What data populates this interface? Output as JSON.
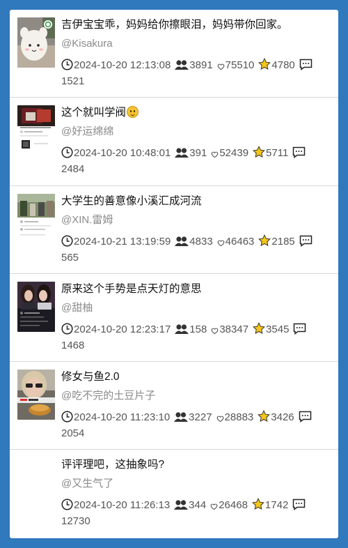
{
  "posts": [
    {
      "title": "吉伊宝宝乖，妈妈给你擦眼泪，妈妈带你回家。",
      "author": "@Kisakura",
      "time": "2024-10-20 12:13:08",
      "plays": "3891",
      "likes": "75510",
      "stars": "4780",
      "comments": "1521",
      "thumb": "chiikawa-plush-thumbnail"
    },
    {
      "title": "这个就叫学阀",
      "author": "@好运绵绵",
      "time": "2024-10-20 10:48:01",
      "plays": "391",
      "likes": "52439",
      "stars": "5711",
      "comments": "2484",
      "thumb": "chat-screenshot-thumbnail"
    },
    {
      "title": "大学生的善意像小溪汇成河流",
      "author": "@XIN.雷姆",
      "time": "2024-10-21 13:19:59",
      "plays": "4833",
      "likes": "46463",
      "stars": "2185",
      "comments": "565",
      "thumb": "campus-photo-thumbnail"
    },
    {
      "title": "原来这个手势是点天灯的意思",
      "author": "@甜柚",
      "time": "2024-10-20 12:23:17",
      "plays": "158",
      "likes": "38347",
      "stars": "3545",
      "comments": "1468",
      "thumb": "two-girls-thumbnail"
    },
    {
      "title": "修女与鱼2.0",
      "author": "@吃不完的土豆片子",
      "time": "2024-10-20 11:23:10",
      "plays": "3227",
      "likes": "28883",
      "stars": "3426",
      "comments": "2054",
      "thumb": "woman-with-food-thumbnail"
    },
    {
      "title": "评评理吧，这抽象吗?",
      "author": "@又生气了",
      "time": "2024-10-20 11:26:13",
      "plays": "344",
      "likes": "26468",
      "stars": "1742",
      "comments": "12730",
      "thumb": ""
    }
  ],
  "colors": {
    "background": "#3079bd",
    "card": "#ffffff",
    "star": "#f5c518"
  },
  "icons": [
    "clock-icon",
    "viewers-icon",
    "heart-icon",
    "star-icon",
    "comment-icon",
    "smile-emoji-icon"
  ]
}
